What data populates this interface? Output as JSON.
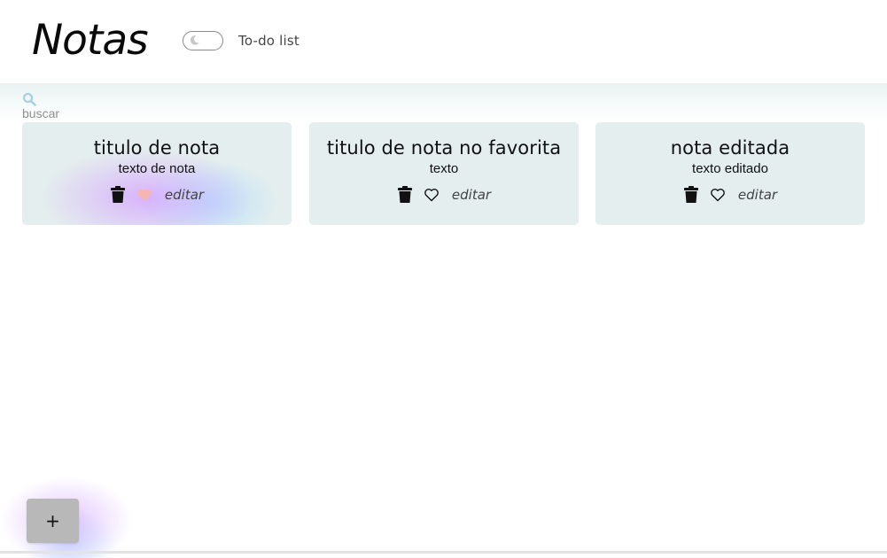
{
  "header": {
    "title": "Notas",
    "toggle_label": "To-do list"
  },
  "search": {
    "placeholder": "buscar",
    "value": ""
  },
  "notes": [
    {
      "title": "titulo de nota",
      "text": "texto de nota",
      "favorite": true,
      "edit_label": "editar"
    },
    {
      "title": "titulo de nota no favorita",
      "text": "texto",
      "favorite": false,
      "edit_label": "editar"
    },
    {
      "title": "nota editada",
      "text": "texto editado",
      "favorite": false,
      "edit_label": "editar"
    }
  ],
  "fab": {
    "label": "+"
  },
  "icons": {
    "search": "search-icon",
    "toggle": "moon-icon",
    "delete": "trash-icon",
    "favorite": "heart-icon"
  },
  "colors": {
    "card_bg": "#e4eeee",
    "favorite_heart": "#f6b6b0",
    "search_icon": "#a8d0e2",
    "fab_bg": "#b8b8b8"
  }
}
